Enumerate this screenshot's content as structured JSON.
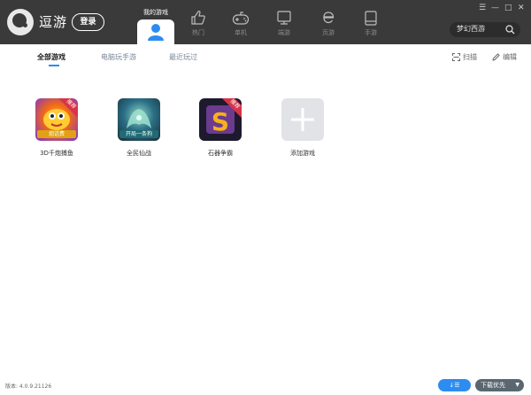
{
  "header": {
    "app_name": "逗游",
    "login_label": "登录",
    "active_nav_label": "我的游戏",
    "nav": [
      {
        "label": "热门",
        "icon": "thumbs-up-icon"
      },
      {
        "label": "单机",
        "icon": "gamepad-icon"
      },
      {
        "label": "端游",
        "icon": "monitor-icon"
      },
      {
        "label": "页游",
        "icon": "ie-icon"
      },
      {
        "label": "手游",
        "icon": "tablet-icon"
      }
    ],
    "search_text": "梦幻西游",
    "window_controls": [
      "☰",
      "—",
      "□",
      "✕"
    ]
  },
  "tabs": [
    {
      "label": "全部游戏",
      "active": true
    },
    {
      "label": "电脑玩手游",
      "active": false
    },
    {
      "label": "最近玩过",
      "active": false
    }
  ],
  "actions": {
    "scan_label": "扫描",
    "edit_label": "编辑"
  },
  "games": [
    {
      "name": "3D千炮捕鱼",
      "badge": "推荐",
      "banner": "炮话费"
    },
    {
      "name": "全民仙战",
      "badge": "",
      "banner": "开局一条狗"
    },
    {
      "name": "石器争霸",
      "badge": "推荐",
      "banner": ""
    },
    {
      "name": "添加游戏",
      "badge": "",
      "banner": ""
    }
  ],
  "footer": {
    "version": "版本: 4.0.9.21126",
    "download_btn": "↓☰",
    "priority_btn": "下载优先"
  },
  "colors": {
    "header_bg": "#3a3a3a",
    "accent": "#2d8cf0",
    "badge": "#d6344a"
  }
}
